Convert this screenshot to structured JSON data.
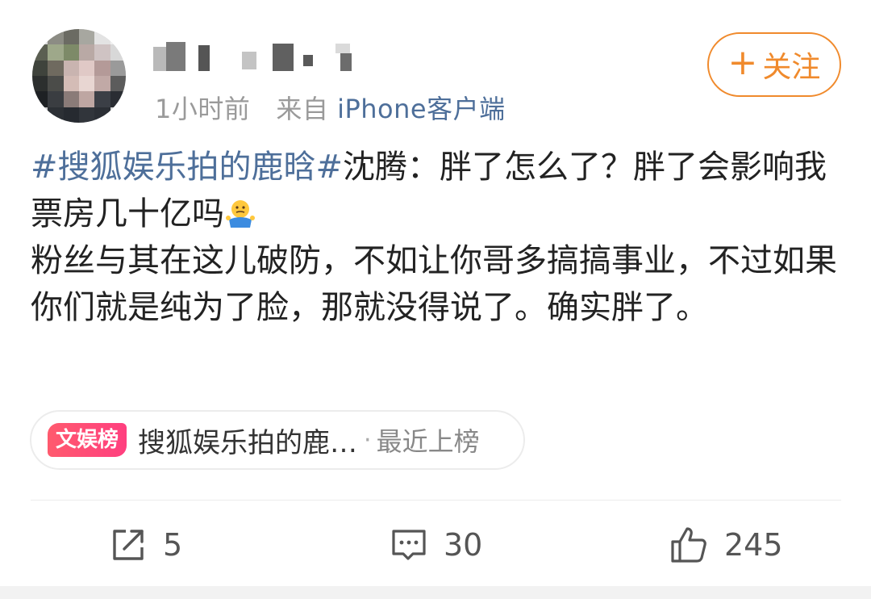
{
  "header": {
    "time": "1小时前",
    "source_prefix": "来自",
    "source": "iPhone客户端",
    "follow_label": "关注",
    "follow_plus": "+"
  },
  "post": {
    "hashtag": "#搜狐娱乐拍的鹿晗#",
    "line1_rest": "沈腾：胖了怎么了？胖了会影响我票房几十亿吗",
    "body": "粉丝与其在这儿破防，不如让你哥多搞搞事业，不过如果你们就是纯为了脸，那就没得说了。确实胖了。"
  },
  "hot": {
    "badge": "文娱榜",
    "title": "搜狐娱乐拍的鹿…",
    "separator": "·",
    "status": "最近上榜"
  },
  "actions": {
    "repost_count": "5",
    "comment_count": "30",
    "like_count": "245"
  },
  "colors": {
    "accent": "#f08a2c",
    "link": "#4e6f9a",
    "badge": "#ff4a74"
  }
}
